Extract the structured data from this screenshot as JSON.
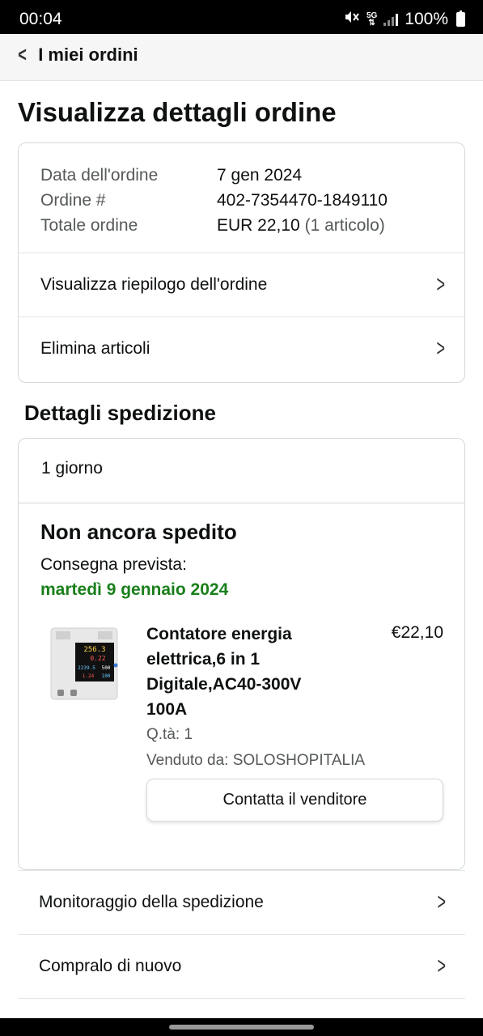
{
  "status_bar": {
    "time": "00:04",
    "network": "5G",
    "battery": "100%",
    "icons": [
      "mute-vibrate-icon",
      "5g-icon",
      "signal-icon",
      "battery-icon"
    ]
  },
  "header": {
    "back_label": "I miei ordini"
  },
  "page_title": "Visualizza dettagli ordine",
  "order_info": {
    "rows": [
      {
        "label": "Data dell'ordine",
        "value": "7 gen 2024",
        "extra": ""
      },
      {
        "label": "Ordine #",
        "value": "402-7354470-1849110",
        "extra": ""
      },
      {
        "label": "Totale ordine",
        "value": "EUR 22,10",
        "extra": "(1 articolo)"
      }
    ],
    "links": [
      {
        "label": "Visualizza riepilogo dell'ordine"
      },
      {
        "label": "Elimina articoli"
      }
    ]
  },
  "shipment": {
    "section_title": "Dettagli spedizione",
    "speed": "1 giorno",
    "status": "Non ancora spedito",
    "delivery_label": "Consegna prevista:",
    "delivery_date": "martedì 9 gennaio 2024",
    "product": {
      "title": "Contatore energia elettrica,6 in 1 Digitale,AC40-300V 100A",
      "price": "€22,10",
      "qty": "Q.tà: 1",
      "seller": "Venduto da: SOLOSHOPITALIA",
      "contact_button": "Contatta il venditore",
      "image_readings": [
        "256.3",
        "0.22",
        "2239.5",
        "500",
        "1.24",
        "100"
      ]
    }
  },
  "actions": [
    {
      "label": "Monitoraggio della spedizione"
    },
    {
      "label": "Compralo di nuovo"
    }
  ],
  "colors": {
    "delivery_green": "#1a7f1a",
    "border": "#d5d9d9",
    "muted_text": "#565959"
  }
}
